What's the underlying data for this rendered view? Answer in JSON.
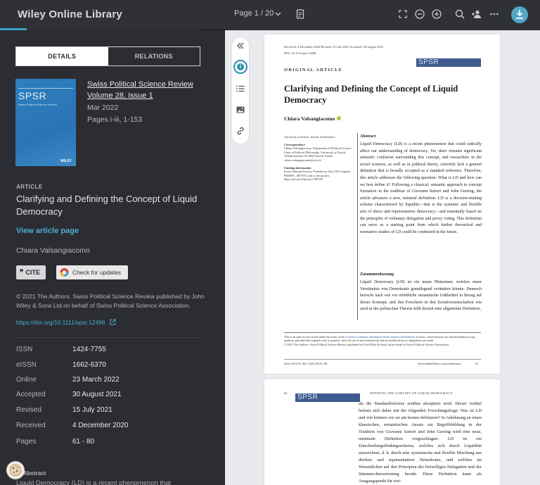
{
  "topbar": {
    "brand": "Wiley Online Library",
    "pager": "Page 1 / 20"
  },
  "tabs": {
    "details": "DETAILS",
    "relations": "RELATIONS"
  },
  "cover": {
    "title": "SPSR",
    "subtitle": "Swiss Political Science Review",
    "publisher": "WILEY"
  },
  "journal": {
    "name": "Swiss Political Science Review",
    "volume": "Volume 28, Issue 1",
    "date": "Mar 2022",
    "pages": "Pages  i-iii, 1-153"
  },
  "article": {
    "label": "ARTICLE",
    "title": "Clarifying and Defining the Concept of Liquid Democracy",
    "view_link": "View article page",
    "author": "Chiara Valsangiacomo",
    "cite": "CITE",
    "updates": "Check for updates",
    "copyright": "© 2021 The Authors. Swiss Political Science Review published by John Wiley & Sons Ltd on behalf of Swiss Political Science Association.",
    "doi": "https://doi.org/10.1111/spsr.12486"
  },
  "meta": {
    "issn_k": "ISSN",
    "issn_v": "1424-7755",
    "eissn_k": "eISSN",
    "eissn_v": "1662-6370",
    "online_k": "Online",
    "online_v": "23 March 2022",
    "accepted_k": "Accepted",
    "accepted_v": "30 August 2021",
    "revised_k": "Revised",
    "revised_v": "15 July 2021",
    "received_k": "Received",
    "received_v": "4 December 2020",
    "pages_k": "Pages",
    "pages_v": "61 - 80"
  },
  "abstract": {
    "heading": "Abstract",
    "text": "Liquid Democracy (LD) is a recent phenomenon that"
  },
  "doc": {
    "received_line": "Received: 4 December 2020     Revised: 15 July 2021     Accepted: 30 August 2021",
    "doi_line": "DOI: 10.1111/spsr.12486",
    "label": "ORIGINAL ARTICLE",
    "logo": "SPSR",
    "title": "Clarifying and Defining the Concept of Liquid Democracy",
    "author": "Chiara Valsangiacomo",
    "affil": "University of Zurich, Zurich, Switzerland",
    "corr_h": "Correspondence",
    "corr": "Chiara Valsangiacomo, Department of Political Science, Chair of Political Philosophy, University of Zurich, Affolternstrasse 56, 8050 Zurich. Email: chiara.valsangiacomo@uzh.ch",
    "fund_h": "Funding information",
    "fund": "Swiss National Science Foundation. Doc.CH recipient: P0ZHP1_180759. Link to the project: https://p3.snf.ch/project-180759",
    "abs_h": "Abstract",
    "abs": "Liquid Democracy (LD) is a recent phenomenon that could radically affect our understanding of democracy. Yet, there remains significant semantic confusion surrounding this concept, and researchers in the social sciences, as well as in political theory, currently lack a general definition that is broadly accepted as a standard reference. Therefore, this article addresses the following question: What is LD and how can we best define it? Following a classical, semantic approach to concept formation in the tradition of Giovanni Sartori and John Gerring, the article advances a new, minimal definition: LD is a decision-making scheme characterized by liquidity—that is the systemic and flexible mix of direct and representative democracy—and essentially based on the principles of voluntary delegation and proxy voting. This definition can serve as a starting point from which further theoretical and normative studies of LD could be conducted in the future.",
    "zus_h": "Zusammenfassung",
    "zus": "Liquid Democracy (LD) ist ein neues Phänomen, welches unser Verständnis von Demokratie grundlegend verändern könnte. Dennoch herrscht nach wie vor erhebliche semantische Unklarheit in Bezug auf dieses Konzept, und den Forschern in den Sozialwissenschaften wie auch in der politischen Theorie fehlt derzeit eine allgemeine Definition,",
    "foot1": "This is an open access article under the terms of the ",
    "foot_link": "Creative Commons Attribution-NonCommercial-NoDerivs",
    "foot2": " License, which permits use and distribution in any medium, provided the original work is properly cited, the use is non-commercial and no modifications or adaptations are made.",
    "foot3": "© 2021 The Authors. Swiss Political Science Review published by John Wiley & Sons Ltd on behalf of Swiss Political Science Association.",
    "foot_left": "Swiss Polit Sci Rev. 2022;28:61–80.",
    "foot_right": "wileyonlinelibrary.com/journal/spsr",
    "page_num": "61",
    "p2_num": "62",
    "p2_running": "DEFINING THE CONCEPT OF LIQUID DEMOCRACY",
    "p2_body": "als die Standardreferenz weithin akzeptiert wird. Dieser Artikel befasst sich daher mit der folgenden Forschungsfrage: Was ist LD und wie können wir sie am besten definieren? In Anlehnung an einen klassischen, semantischen Ansatz zur Begriffsbildung in der Tradition von Giovanni Sartori und John Gerring wird eine neue, minimale Definition vorgeschlagen: LD ist ein Entscheidungsfindungsschema, welches sich durch Liquidität auszeichnet, d. h. durch eine systemische und flexible Mischung aus direkter und repräsentativer Demokratie, und welches im Wesentlichen auf den Prinzipien der freiwilligen Delegation und der Stimmrechtsvertretung beruht. Diese Definition kann als Ausgangspunkt für wei-"
  },
  "colors": {
    "accent": "#4aaed2",
    "panel": "#2b2d33",
    "viewer_bg": "#e9eaed",
    "logo_bar": "#3f5a8f"
  },
  "icons": [
    "chevron-down-icon",
    "document-icon",
    "fullscreen-icon",
    "zoom-out-icon",
    "zoom-in-icon",
    "search-icon",
    "add-user-icon",
    "more-icon",
    "download-icon",
    "collapse-icon",
    "info-icon",
    "list-icon",
    "image-icon",
    "link-icon",
    "external-link-icon",
    "cookie-icon"
  ]
}
